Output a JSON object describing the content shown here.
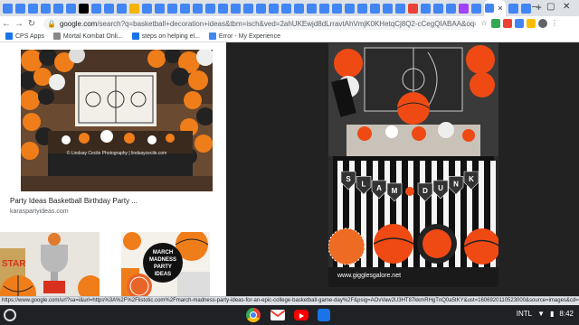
{
  "browser": {
    "url_host": "google.com",
    "url_path": "/search?q=basketball+decoration+ideas&tbm=isch&ved=2ahUKEwjd8dLrravtAhVmjK0KHetqCj8Q2-cCegQIABAA&oq=basketball+dec&gs_l...",
    "bookmarks": [
      {
        "label": "CPS Apps",
        "color": "#1a73e8"
      },
      {
        "label": "Mortal Kombat Onli...",
        "color": "#888888"
      },
      {
        "label": "steps on helping el...",
        "color": "#1a73e8"
      },
      {
        "label": "Error - My Experience",
        "color": "#4285f4"
      }
    ],
    "tab_icons": [
      "#4285f4",
      "#4285f4",
      "#4285f4",
      "#4285f4",
      "#4285f4",
      "#4285f4",
      "#000000",
      "#4285f4",
      "#4285f4",
      "#4285f4",
      "#f4b400",
      "#4285f4",
      "#4285f4",
      "#4285f4",
      "#4285f4",
      "#4285f4",
      "#4285f4",
      "#4285f4",
      "#4285f4",
      "#4285f4",
      "#4285f4",
      "#4285f4",
      "#4285f4",
      "#4285f4",
      "#4285f4",
      "#4285f4",
      "#4285f4",
      "#4285f4",
      "#4285f4",
      "#4285f4",
      "#4285f4",
      "#4285f4",
      "#ea4335",
      "#4285f4",
      "#4285f4",
      "#4285f4",
      "#a142f4",
      "#4285f4",
      "#4285f4",
      "#4285f4",
      "#4285f4"
    ]
  },
  "results": {
    "first_title": "Party Ideas Basketball Birthday Party ...",
    "first_source": "karaspartyideas.com",
    "img1_watermark": "© Lindsay Cecile Photography | lindsaycecile.com",
    "march_madness": [
      "MARCH",
      "MADNESS",
      "PARTY",
      "IDEAS"
    ],
    "trophy_text": "STAR"
  },
  "preview": {
    "banner_letters": [
      "S",
      "L",
      "A",
      "M",
      "",
      "D",
      "U",
      "N",
      "K"
    ],
    "watermark": "www.gigglesgalore.net"
  },
  "status_url": "https://www.google.com/url?sa=i&url=https%3A%2F%2Flistotic.com%2Fmarch-madness-party-ideas-for-an-epic-college-basketball-game-day%2F&psig=AOvVaw2U3HT87kkmRHgTnQ0a5tKY&ust=1606920110523000&source=images&cd=...",
  "shelf": {
    "apps": [
      {
        "name": "chrome",
        "color": "#4285f4"
      },
      {
        "name": "gmail",
        "color": "#ffffff"
      },
      {
        "name": "youtube",
        "color": "#ff0000"
      },
      {
        "name": "files",
        "color": "#1a73e8"
      }
    ],
    "tray_input": "INTL",
    "tray_time": "8:42"
  }
}
